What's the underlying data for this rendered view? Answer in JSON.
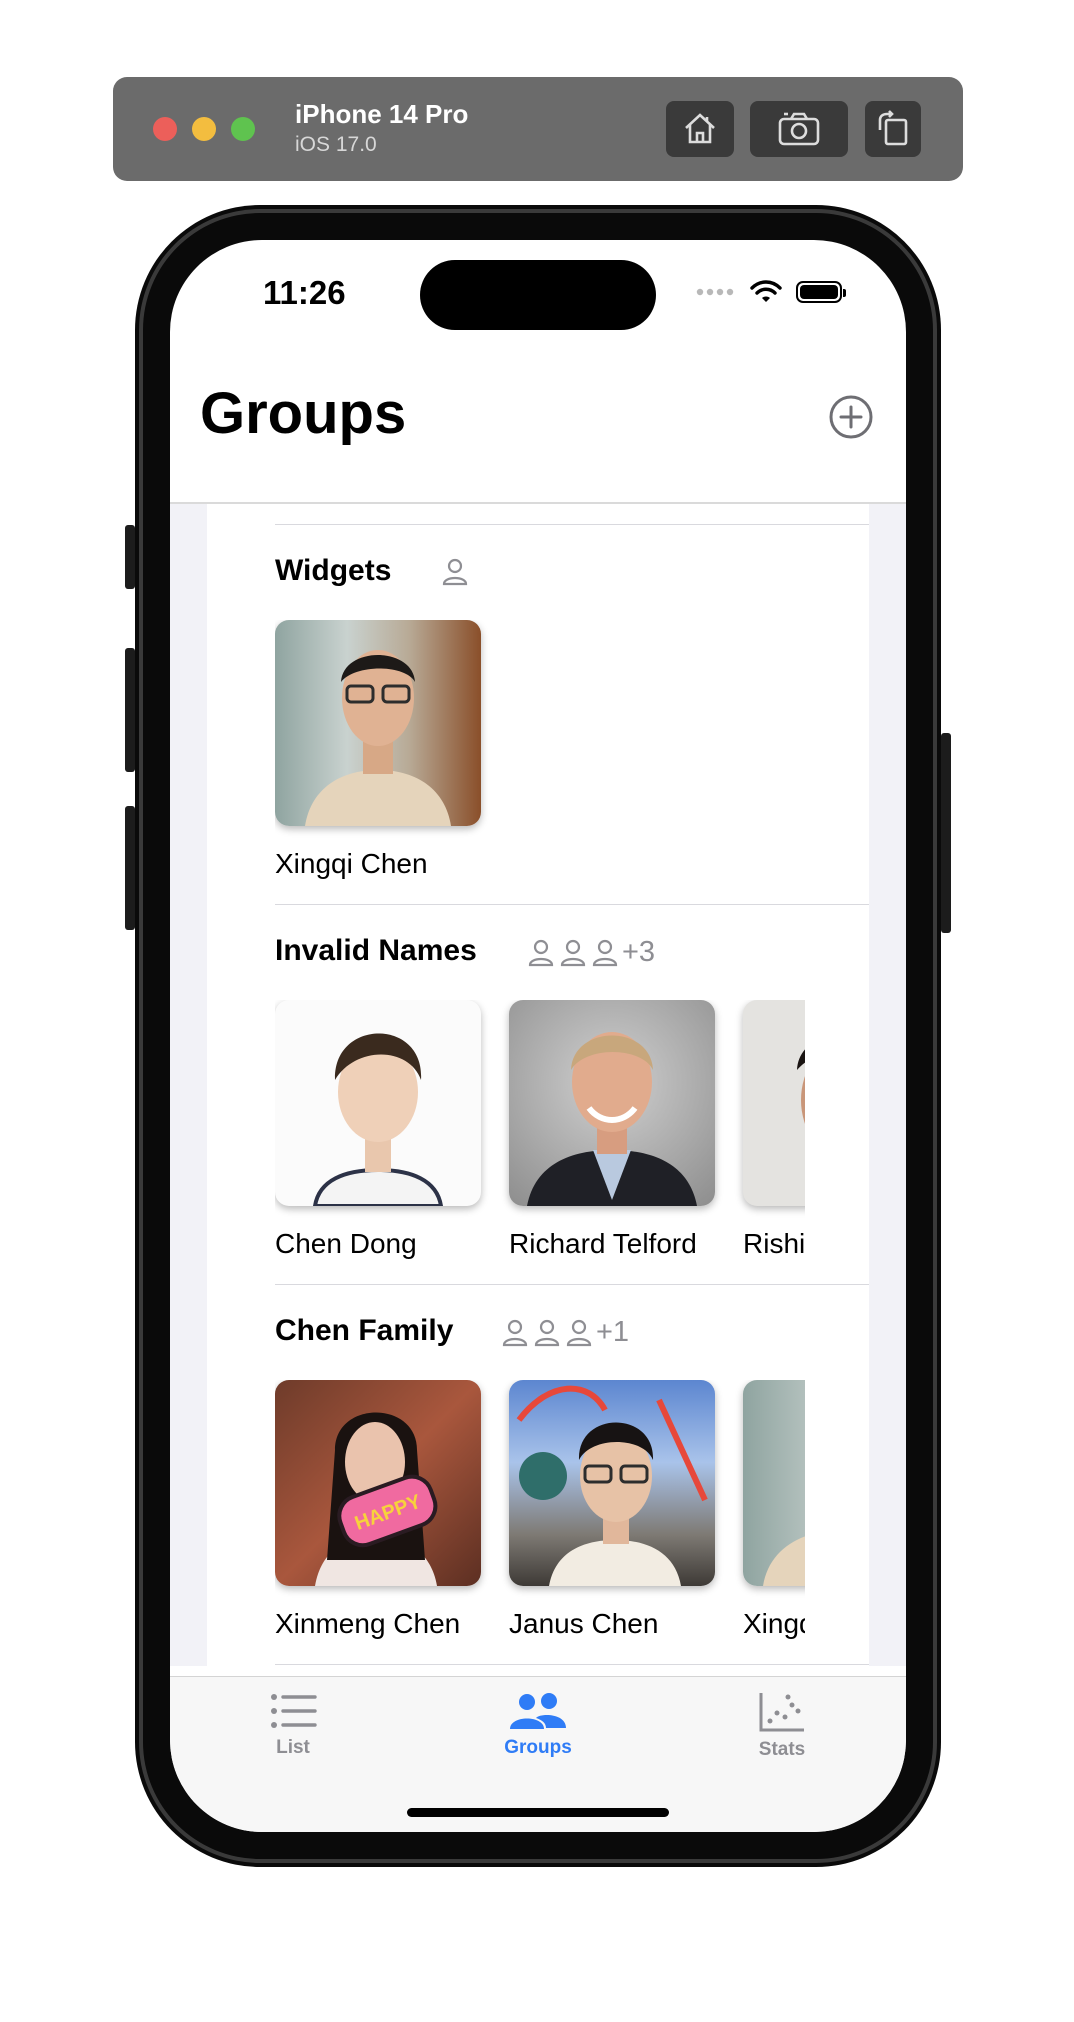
{
  "simulator": {
    "device": "iPhone 14 Pro",
    "os": "iOS 17.0",
    "buttons": [
      "home-icon",
      "screenshot-icon",
      "rotate-icon"
    ]
  },
  "status_bar": {
    "time": "11:26"
  },
  "nav": {
    "title": "Groups",
    "add_icon": "plus-circle-icon"
  },
  "groups": [
    {
      "title": "Widgets",
      "member_count_extra": "",
      "members": [
        {
          "name": "Xingqi Chen"
        }
      ]
    },
    {
      "title": "Invalid Names",
      "member_count_extra": "+3",
      "members": [
        {
          "name": "Chen Dong"
        },
        {
          "name": "Richard Telford"
        },
        {
          "name": "Rishi"
        }
      ]
    },
    {
      "title": "Chen Family",
      "member_count_extra": "+1",
      "members": [
        {
          "name": "Xinmeng Chen"
        },
        {
          "name": "Janus Chen"
        },
        {
          "name": "Xingq"
        }
      ]
    }
  ],
  "tabs": [
    {
      "label": "List",
      "icon": "list-icon",
      "active": false
    },
    {
      "label": "Groups",
      "icon": "people-icon",
      "active": true
    },
    {
      "label": "Stats",
      "icon": "scatter-chart-icon",
      "active": false
    }
  ],
  "colors": {
    "accent": "#2f7cf6",
    "secondary": "#8e8e93",
    "background": "#f2f2f7"
  }
}
